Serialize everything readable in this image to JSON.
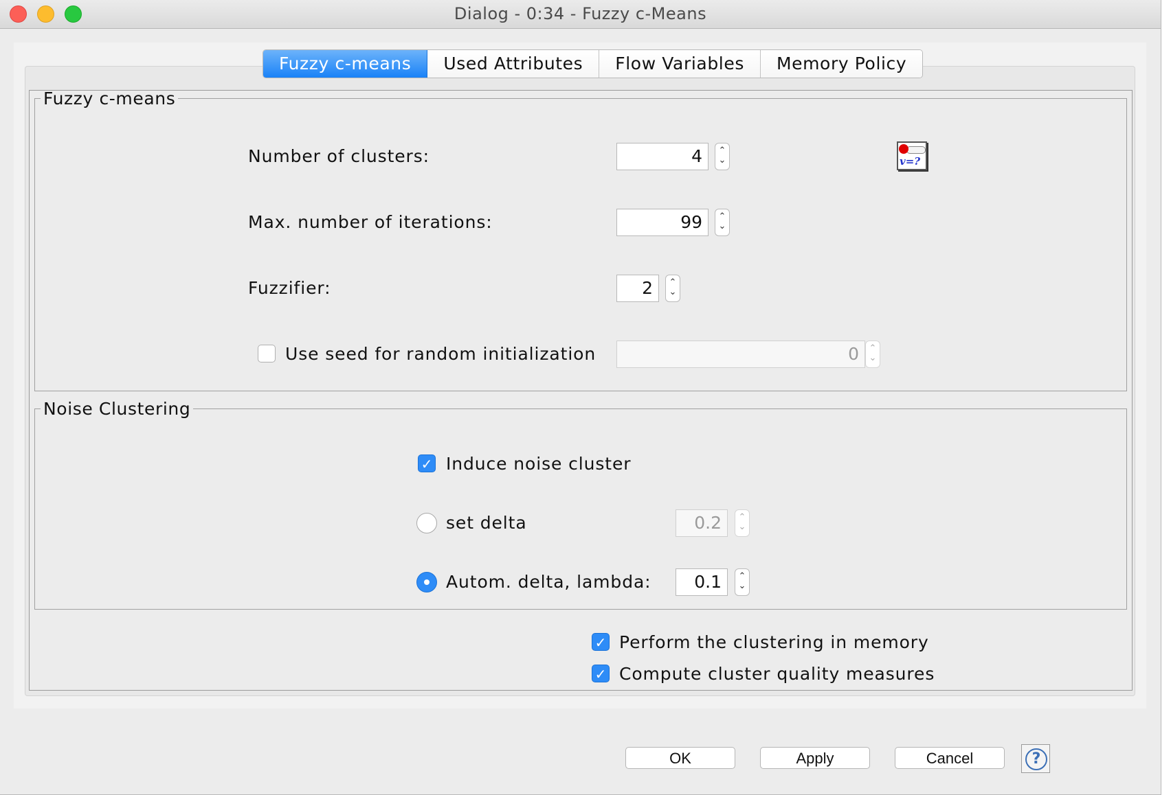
{
  "window": {
    "title": "Dialog - 0:34 - Fuzzy c-Means"
  },
  "tabs": [
    {
      "label": "Fuzzy c-means",
      "active": true
    },
    {
      "label": "Used Attributes",
      "active": false
    },
    {
      "label": "Flow Variables",
      "active": false
    },
    {
      "label": "Memory Policy",
      "active": false
    }
  ],
  "fuzzy": {
    "legend": "Fuzzy c-means",
    "clusters_label": "Number of clusters:",
    "clusters_value": "4",
    "iterations_label": "Max. number of iterations:",
    "iterations_value": "99",
    "fuzzifier_label": "Fuzzifier:",
    "fuzzifier_value": "2",
    "seed_label": "Use seed for random initialization",
    "seed_checked": false,
    "seed_value": "0",
    "flow_var_icon": "flow-variable-icon",
    "flow_var_text": "v=?"
  },
  "noise": {
    "legend": "Noise Clustering",
    "induce_label": "Induce noise cluster",
    "induce_checked": true,
    "set_delta_label": "set delta",
    "set_delta_value": "0.2",
    "auto_label": "Autom. delta, lambda:",
    "auto_value": "0.1",
    "selected_option": "auto"
  },
  "options": {
    "memory_label": "Perform the clustering in memory",
    "memory_checked": true,
    "quality_label": "Compute cluster quality measures",
    "quality_checked": true
  },
  "buttons": {
    "ok": "OK",
    "apply": "Apply",
    "cancel": "Cancel",
    "help": "?"
  },
  "colors": {
    "accent": "#2e8cf7",
    "close": "#fc5f57",
    "minimize": "#fdbc2e",
    "maximize": "#28c840"
  }
}
